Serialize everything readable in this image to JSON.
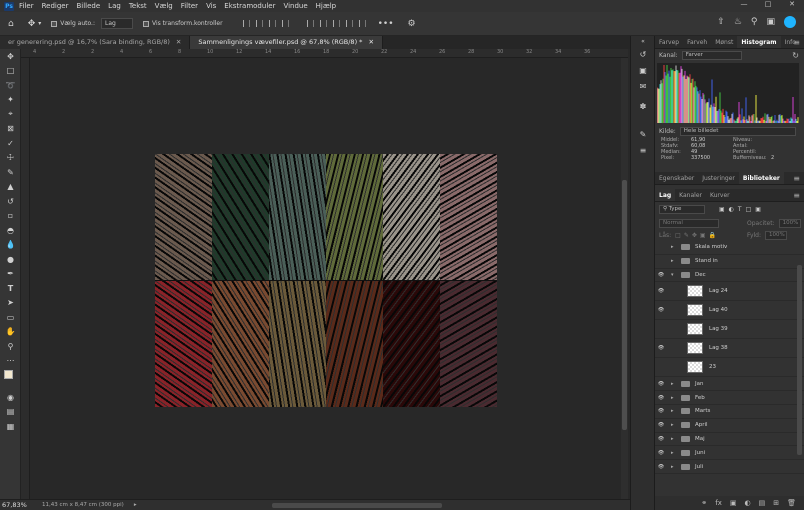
{
  "app": {
    "logo": "Ps"
  },
  "menubar": {
    "items": [
      "Filer",
      "Rediger",
      "Billede",
      "Lag",
      "Tekst",
      "Vælg",
      "Filter",
      "Vis",
      "Ekstramoduler",
      "Vindue",
      "Hjælp"
    ]
  },
  "optionsbar": {
    "autoselect_label": "Vælg auto.:",
    "autoselect_value": "Lag",
    "transform_label": "Vis transform.kontroller",
    "more_label": "•••"
  },
  "tabs": [
    {
      "label": "er generering.psd @ 16,7% (Sara binding, RGB/8)",
      "active": false
    },
    {
      "label": "Sammenlignings vævefiler.psd @ 67,8% (RGB/8) *",
      "active": true
    }
  ],
  "rulers": {
    "top": [
      "4",
      "2",
      "2",
      "4",
      "6",
      "8",
      "10",
      "12",
      "14",
      "16",
      "18",
      "20",
      "22",
      "24",
      "26",
      "28",
      "30",
      "32",
      "34",
      "36"
    ]
  },
  "statusbar": {
    "zoom": "67,83%",
    "doc_info": "11,43 cm x 8,47 cm (300 ppi)"
  },
  "panel_top": {
    "tabs": [
      "Farvep",
      "Farveh",
      "Mønst",
      "Histogram",
      "Info"
    ],
    "active_tab": "Histogram",
    "channel_label": "Kanal:",
    "channel_value": "Farver",
    "source_label": "Kilde:",
    "source_value": "Hele billedet",
    "stats_left": [
      [
        "Middel:",
        "61,90"
      ],
      [
        "Stdafv:",
        "60,08"
      ],
      [
        "Median:",
        "49"
      ],
      [
        "Pixel:",
        "337500"
      ]
    ],
    "stats_right": [
      [
        "Niveau:",
        ""
      ],
      [
        "Antal:",
        ""
      ],
      [
        "Percentil:",
        ""
      ],
      [
        "Bufferniveau:",
        "2"
      ]
    ]
  },
  "panel_mid": {
    "tabs": [
      "Egenskaber",
      "Justeringer",
      "Biblioteker"
    ],
    "active_tab": "Biblioteker"
  },
  "layers_panel": {
    "tabs": [
      "Lag",
      "Kanaler",
      "Kurver"
    ],
    "active_tab": "Lag",
    "filter_value": "Type",
    "blend_mode": "Normal",
    "opacity_label": "Opacitet:",
    "opacity_value": "100%",
    "lock_label": "Lås:",
    "fill_label": "Fyld:",
    "fill_value": "100%",
    "layers": [
      {
        "name": "Skala motiv",
        "kind": "folder",
        "visible": false,
        "indent": 0
      },
      {
        "name": "Stand in",
        "kind": "folder",
        "visible": false,
        "indent": 0
      },
      {
        "name": "Dec",
        "kind": "folder",
        "visible": true,
        "indent": 0,
        "open": true
      },
      {
        "name": "Lag 24",
        "kind": "layer",
        "visible": true,
        "indent": 1
      },
      {
        "name": "Lag 40",
        "kind": "layer",
        "visible": true,
        "indent": 1
      },
      {
        "name": "Lag 39",
        "kind": "layer",
        "visible": false,
        "indent": 1
      },
      {
        "name": "Lag 38",
        "kind": "layer",
        "visible": true,
        "indent": 1
      },
      {
        "name": "23",
        "kind": "layer",
        "visible": false,
        "indent": 1
      },
      {
        "name": "Jan",
        "kind": "folder",
        "visible": true,
        "indent": 0
      },
      {
        "name": "Feb",
        "kind": "folder",
        "visible": true,
        "indent": 0
      },
      {
        "name": "Marts",
        "kind": "folder",
        "visible": true,
        "indent": 0
      },
      {
        "name": "April",
        "kind": "folder",
        "visible": true,
        "indent": 0
      },
      {
        "name": "Maj",
        "kind": "folder",
        "visible": true,
        "indent": 0
      },
      {
        "name": "Juni",
        "kind": "folder",
        "visible": true,
        "indent": 0
      },
      {
        "name": "Juli",
        "kind": "folder",
        "visible": true,
        "indent": 0
      }
    ]
  },
  "colors": {
    "accent": "#31a8ff",
    "tiles_top": [
      "#6b5a4e",
      "#1f3a2a",
      "#4a5f58",
      "#5f6a3a",
      "#9a948a",
      "#8a6a6a"
    ],
    "tiles_bottom": [
      "#8a2228",
      "#7a4a30",
      "#6b5a3a",
      "#5a2a1a",
      "#2a0808",
      "#4a2a30"
    ]
  }
}
